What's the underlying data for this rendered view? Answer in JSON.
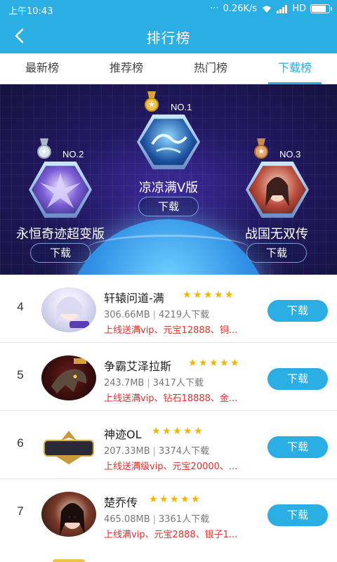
{
  "status": {
    "time": "上午10:43",
    "network": "0.26K/s",
    "hd": "HD",
    "battery_level": 0.85
  },
  "header": {
    "title": "排行榜"
  },
  "tabs": [
    {
      "label": "最新榜",
      "active": false
    },
    {
      "label": "推荐榜",
      "active": false
    },
    {
      "label": "热门榜",
      "active": false
    },
    {
      "label": "下载榜",
      "active": true
    }
  ],
  "top3": [
    {
      "rank": "NO.1",
      "name": "凉凉满V版",
      "button": "下载",
      "medal": "gold"
    },
    {
      "rank": "NO.2",
      "name": "永恒奇迹超变版",
      "button": "下载",
      "medal": "silver"
    },
    {
      "rank": "NO.3",
      "name": "战国无双传",
      "button": "下载",
      "medal": "bronze"
    }
  ],
  "list": [
    {
      "rank": "4",
      "name": "轩辕问道-满",
      "rating": 5,
      "size": "306.66MB",
      "downloads": "4219人下载",
      "promo": "上线送满vip、元宝12888、铜...",
      "button": "下载"
    },
    {
      "rank": "5",
      "name": "争霸艾泽拉斯",
      "rating": 5,
      "size": "243.7MB",
      "downloads": "3417人下载",
      "promo": "上线送满vip、钻石18888、金...",
      "button": "下载"
    },
    {
      "rank": "6",
      "name": "神迹OL",
      "rating": 5,
      "size": "207.33MB",
      "downloads": "3374人下载",
      "promo": "上线送满级vip、元宝20000、...",
      "button": "下载"
    },
    {
      "rank": "7",
      "name": "楚乔传",
      "rating": 5,
      "size": "465.08MB",
      "downloads": "3361人下载",
      "promo": "上线满vip、元宝2888、银子1...",
      "button": "下载"
    }
  ],
  "colors": {
    "primary": "#2aaee4",
    "promo": "#e0312f",
    "star": "#f4b400"
  }
}
